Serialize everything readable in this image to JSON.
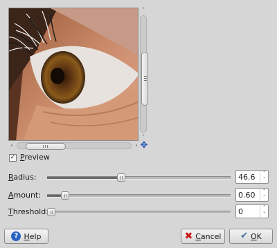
{
  "preview": {
    "checkbox_mark": "✓",
    "label_mnemonic": "P",
    "label_rest": "review"
  },
  "scroll": {
    "up_arrow": "˄",
    "down_arrow": "˅",
    "left_arrow": "‹",
    "right_arrow": "›",
    "navigate_icon": "✥"
  },
  "params": [
    {
      "mnemonic": "R",
      "rest": "adius:",
      "value": "46.6",
      "level": 0.4
    },
    {
      "mnemonic": "A",
      "rest": "mount:",
      "value": "0.60",
      "level": 0.08
    },
    {
      "mnemonic": "T",
      "rest": "hreshold:",
      "value": "0",
      "level": 0.0
    }
  ],
  "spin_arrows": {
    "up": "˄",
    "down": "˅"
  },
  "buttons": {
    "help": {
      "mnemonic": "H",
      "rest": "elp",
      "icon": "help-icon"
    },
    "cancel": {
      "mnemonic": "C",
      "rest": "ancel",
      "icon": "cancel-icon"
    },
    "ok": {
      "mnemonic": "O",
      "rest": "K",
      "icon": "checkmark-icon"
    }
  },
  "colors": {
    "background": "#d6d6d6",
    "accent": "#2b63c3",
    "cancel": "#cc1b1b"
  }
}
